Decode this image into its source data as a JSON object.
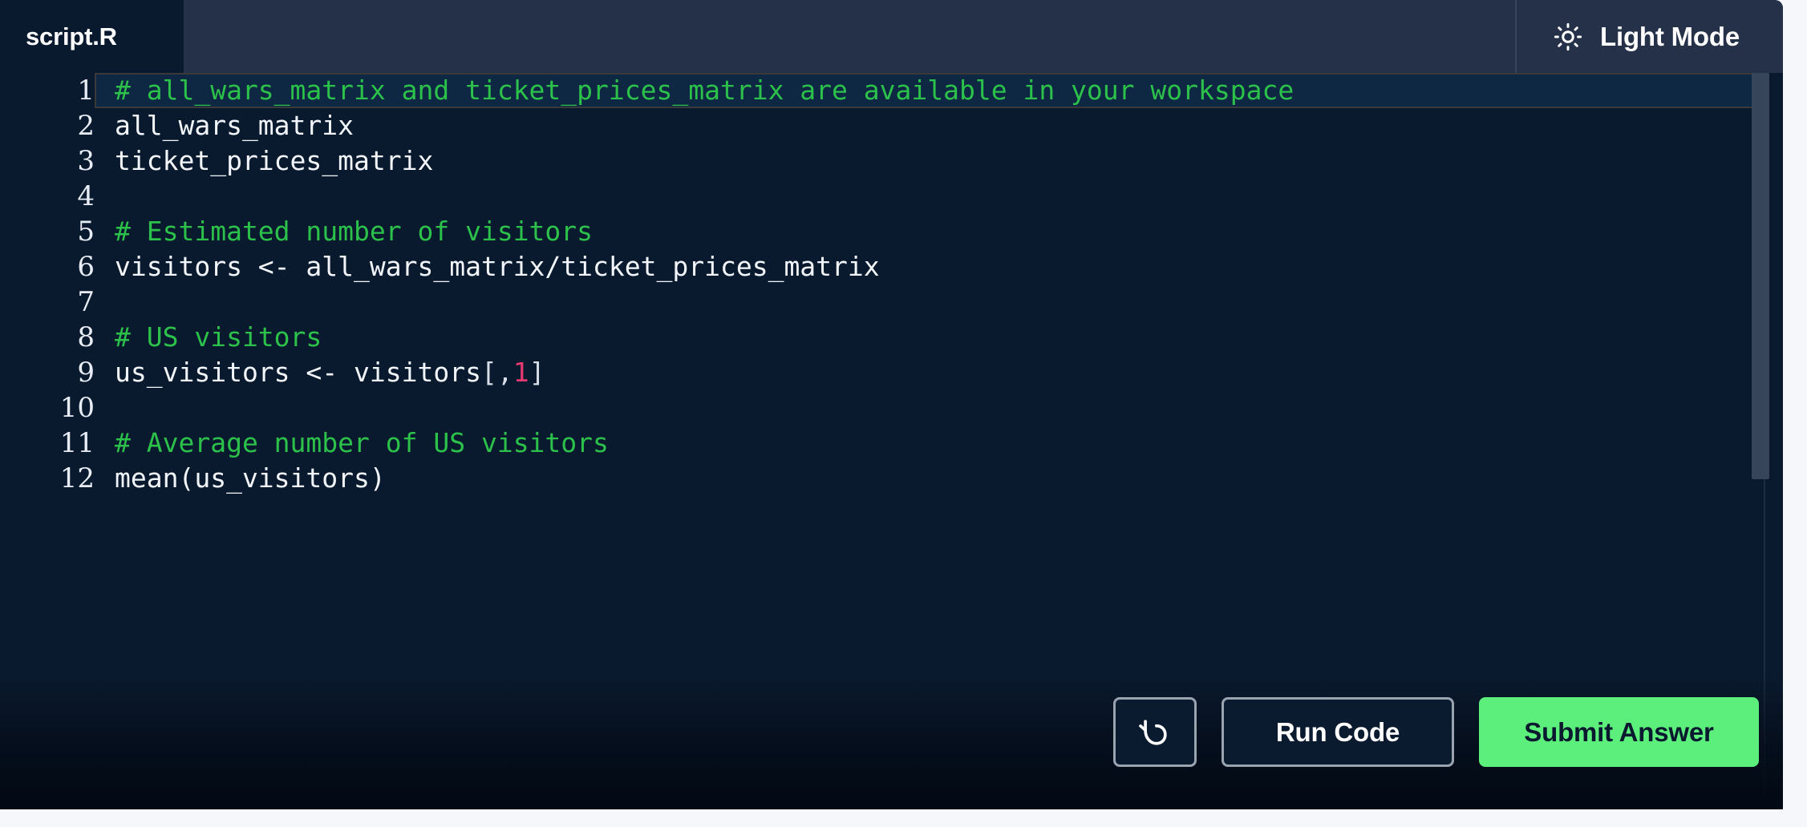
{
  "header": {
    "tab_label": "script.R",
    "light_mode_label": "Light Mode",
    "sun_icon": "sun-icon"
  },
  "editor": {
    "language": "R",
    "active_line": 1,
    "lines": [
      {
        "number": "1",
        "active": true,
        "tokens": [
          {
            "type": "comment",
            "text": "# all_wars_matrix and ticket_prices_matrix are available in your workspace"
          }
        ]
      },
      {
        "number": "2",
        "active": false,
        "tokens": [
          {
            "type": "plain",
            "text": "all_wars_matrix"
          }
        ]
      },
      {
        "number": "3",
        "active": false,
        "tokens": [
          {
            "type": "plain",
            "text": "ticket_prices_matrix"
          }
        ]
      },
      {
        "number": "4",
        "active": false,
        "tokens": [
          {
            "type": "plain",
            "text": ""
          }
        ]
      },
      {
        "number": "5",
        "active": false,
        "tokens": [
          {
            "type": "comment",
            "text": "# Estimated number of visitors"
          }
        ]
      },
      {
        "number": "6",
        "active": false,
        "tokens": [
          {
            "type": "plain",
            "text": "visitors <- all_wars_matrix/ticket_prices_matrix"
          }
        ]
      },
      {
        "number": "7",
        "active": false,
        "tokens": [
          {
            "type": "plain",
            "text": ""
          }
        ]
      },
      {
        "number": "8",
        "active": false,
        "tokens": [
          {
            "type": "comment",
            "text": "# US visitors"
          }
        ]
      },
      {
        "number": "9",
        "active": false,
        "tokens": [
          {
            "type": "plain",
            "text": "us_visitors <- visitors"
          },
          {
            "type": "punct",
            "text": "[,"
          },
          {
            "type": "num",
            "text": "1"
          },
          {
            "type": "punct",
            "text": "]"
          }
        ]
      },
      {
        "number": "10",
        "active": false,
        "tokens": [
          {
            "type": "plain",
            "text": ""
          }
        ]
      },
      {
        "number": "11",
        "active": false,
        "tokens": [
          {
            "type": "comment",
            "text": "# Average number of US visitors"
          }
        ]
      },
      {
        "number": "12",
        "active": false,
        "tokens": [
          {
            "type": "plain",
            "text": "mean(us_visitors)"
          }
        ]
      }
    ]
  },
  "actions": {
    "reset_icon": "reset-arrow-icon",
    "run_label": "Run Code",
    "submit_label": "Submit Answer"
  },
  "colors": {
    "editor_background": "#0a1a2e",
    "header_background": "#243148",
    "comment_green": "#2cc14a",
    "number_pink": "#e73a73",
    "submit_green": "#5cef7c",
    "page_background": "#f6f7fb",
    "scrollbar_thumb": "#37455a"
  }
}
